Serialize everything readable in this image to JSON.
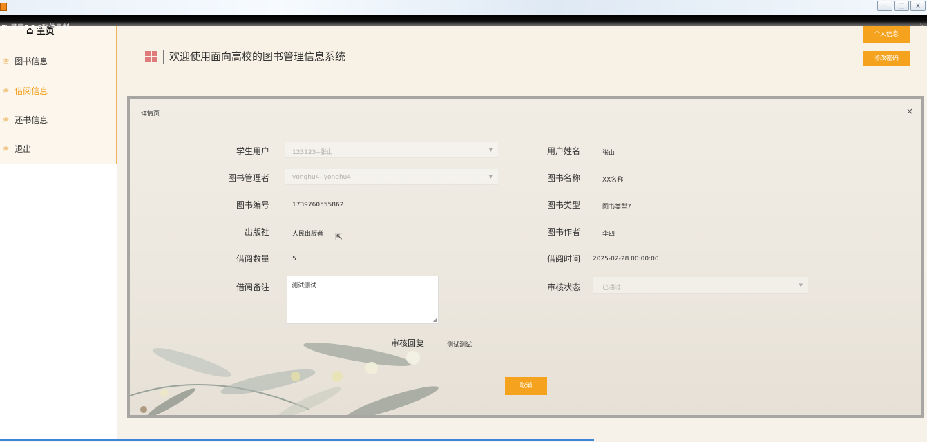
{
  "window": {
    "recorder_label": "EV录屏5.2.8软件录制"
  },
  "sidebar": {
    "home": "主页",
    "items": [
      {
        "label": "图书信息",
        "active": false
      },
      {
        "label": "借阅信息",
        "active": true
      },
      {
        "label": "还书信息",
        "active": false
      },
      {
        "label": "退出",
        "active": false
      }
    ]
  },
  "header": {
    "title": "欢迎使用面向高校的图书管理信息系统",
    "profile_button": "个人信息",
    "password_button": "修改密码"
  },
  "modal": {
    "title": "详情页",
    "close": "×",
    "fields": {
      "student_user": {
        "label": "学生用户",
        "value": "123123--张山"
      },
      "user_name": {
        "label": "用户姓名",
        "value": "张山"
      },
      "librarian": {
        "label": "图书管理者",
        "value": "yonghu4--yonghu4"
      },
      "book_name": {
        "label": "图书名称",
        "value": "XX名称"
      },
      "book_number": {
        "label": "图书编号",
        "value": "1739760555862"
      },
      "book_type": {
        "label": "图书类型",
        "value": "图书类型7"
      },
      "publisher": {
        "label": "出版社",
        "value": "人民出版者"
      },
      "author": {
        "label": "图书作者",
        "value": "李四"
      },
      "borrow_qty": {
        "label": "借阅数量",
        "value": "5"
      },
      "borrow_time": {
        "label": "借阅时间",
        "value": "2025-02-28 00:00:00"
      },
      "borrow_note": {
        "label": "借阅备注",
        "value": "测试测试"
      },
      "review_status": {
        "label": "审核状态",
        "value": "已通过"
      },
      "review_reply": {
        "label": "审核回复",
        "value": "测试测试"
      }
    },
    "cancel_button": "取消"
  },
  "colors": {
    "accent": "#f5a21e",
    "active_nav": "#f39a10",
    "tiles": "#e07b7b"
  }
}
